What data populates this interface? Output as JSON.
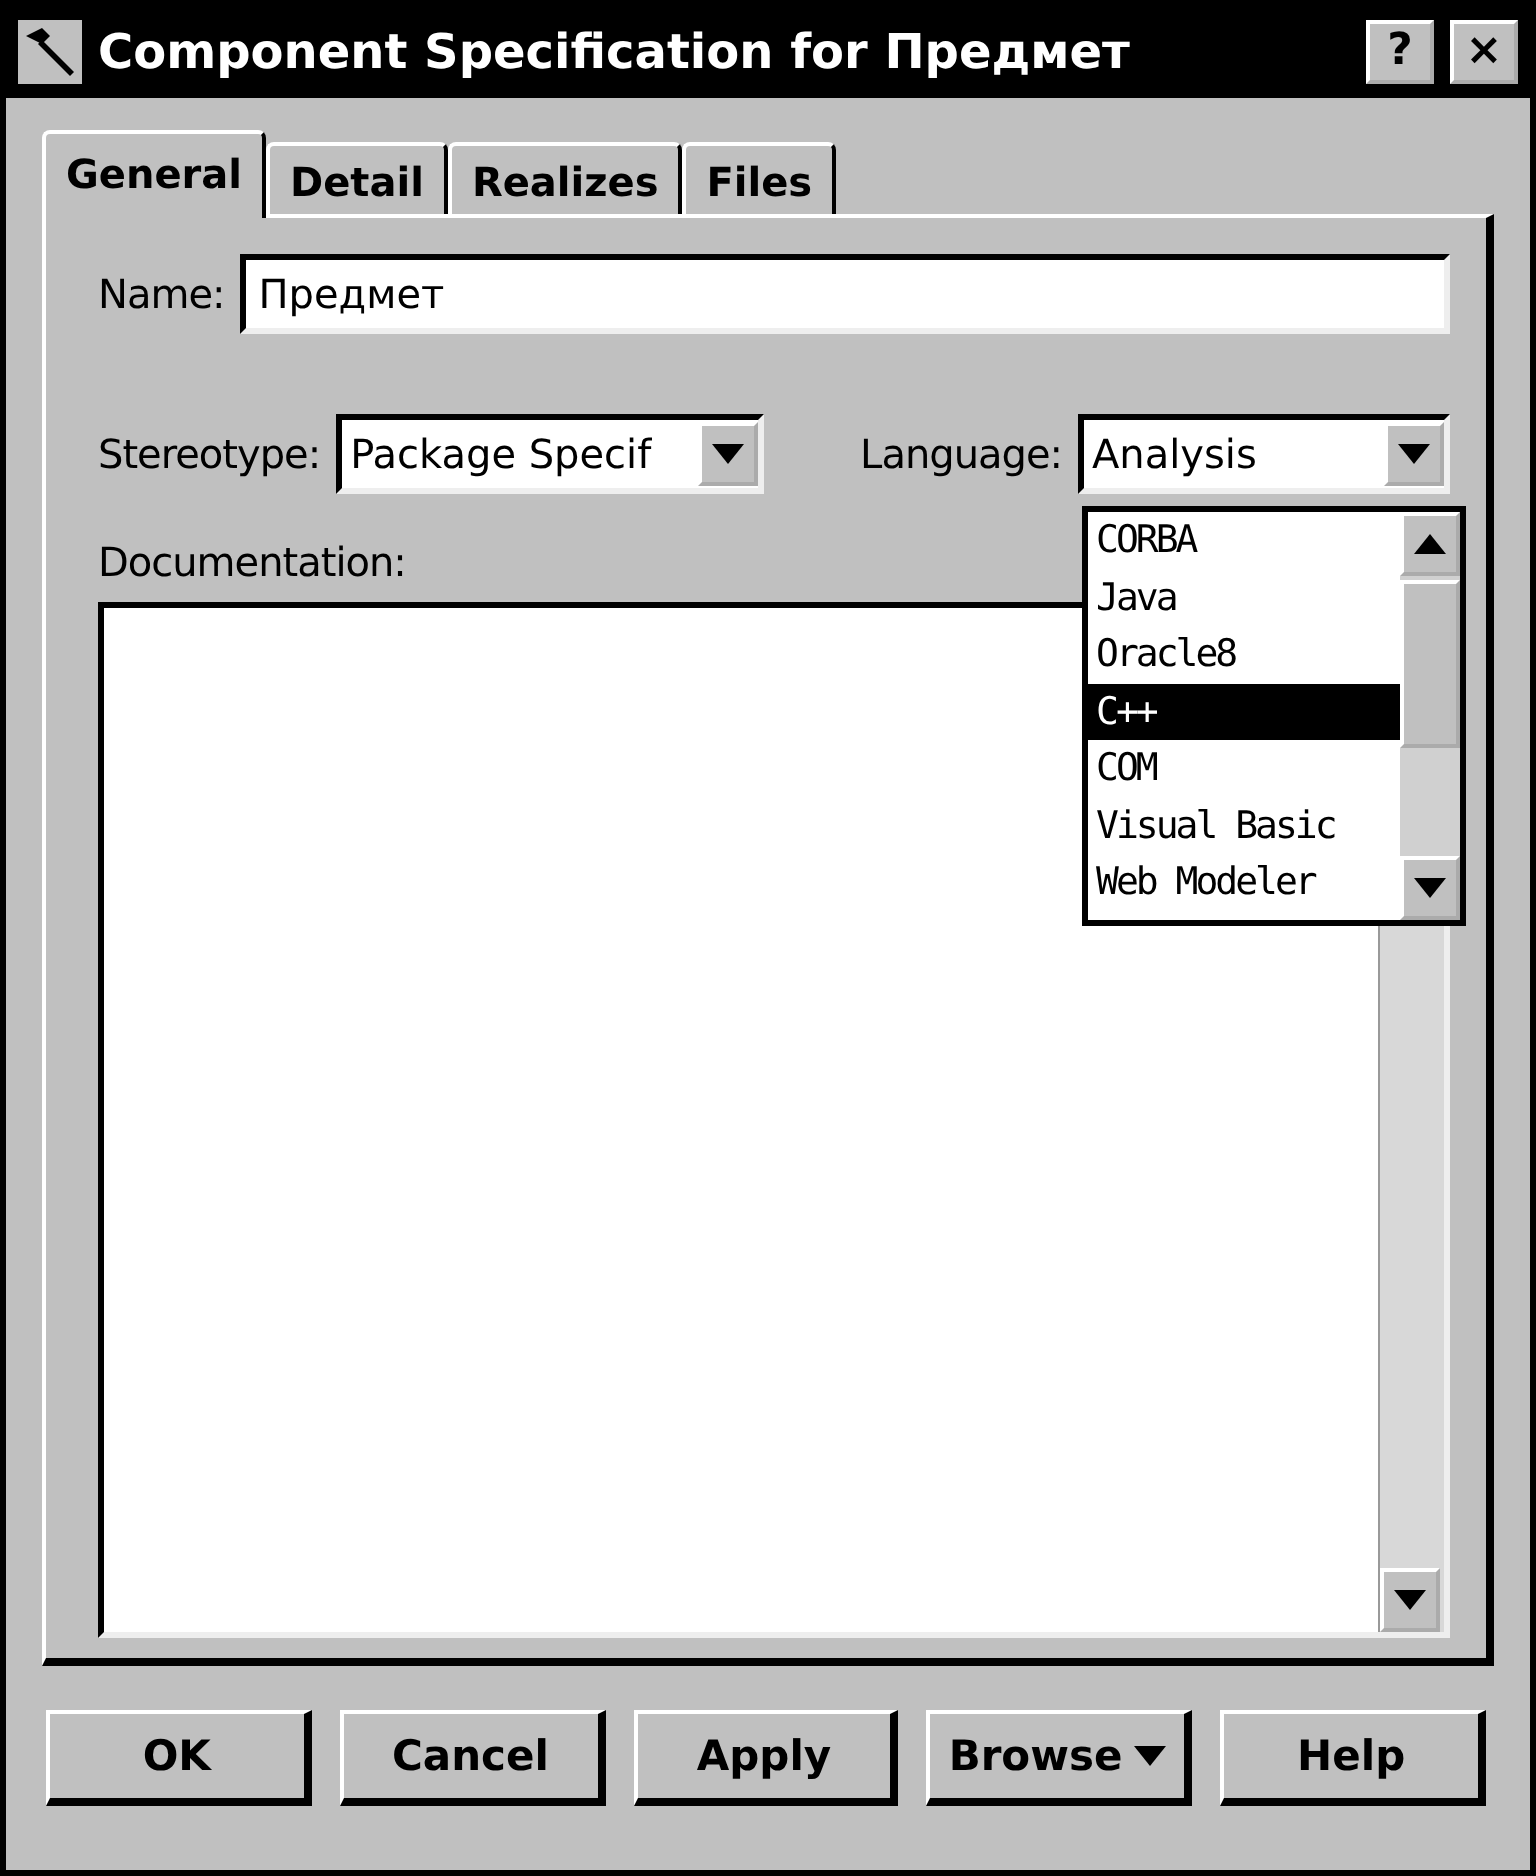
{
  "window": {
    "title": "Component Specification for Предмет",
    "help_button": "?",
    "close_button": "×"
  },
  "tabs": [
    {
      "label": "General",
      "selected": true
    },
    {
      "label": "Detail",
      "selected": false
    },
    {
      "label": "Realizes",
      "selected": false
    },
    {
      "label": "Files",
      "selected": false
    }
  ],
  "name": {
    "label": "Name:",
    "value": "Предмет"
  },
  "stereotype": {
    "label": "Stereotype:",
    "value": "Package Specif"
  },
  "language": {
    "label": "Language:",
    "value": "Analysis",
    "expanded": true,
    "options": [
      {
        "label": "CORBA",
        "selected": false
      },
      {
        "label": "Java",
        "selected": false
      },
      {
        "label": "Oracle8",
        "selected": false
      },
      {
        "label": "C++",
        "selected": true
      },
      {
        "label": "COM",
        "selected": false
      },
      {
        "label": "Visual Basic",
        "selected": false
      },
      {
        "label": "Web Modeler",
        "selected": false
      }
    ]
  },
  "documentation": {
    "label": "Documentation:"
  },
  "buttons": [
    {
      "label": "OK",
      "menu": false
    },
    {
      "label": "Cancel",
      "menu": false
    },
    {
      "label": "Apply",
      "menu": false
    },
    {
      "label": "Browse",
      "menu": true
    },
    {
      "label": "Help",
      "menu": false
    }
  ]
}
